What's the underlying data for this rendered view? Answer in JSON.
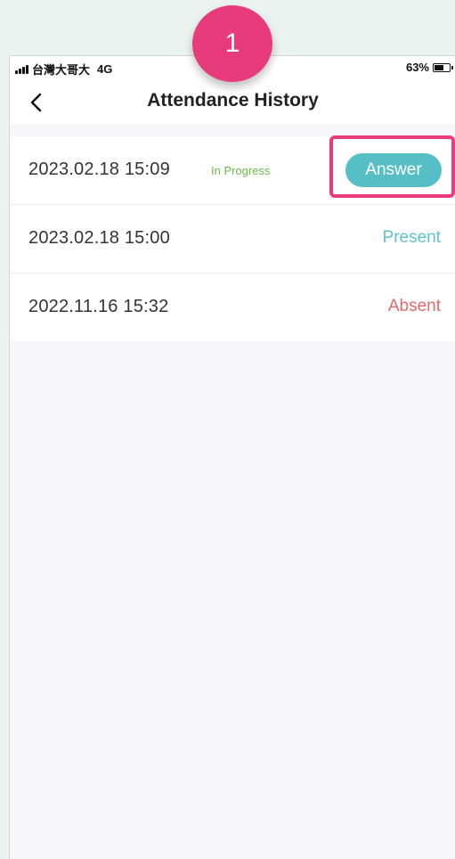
{
  "status_bar": {
    "carrier": "台灣大哥大",
    "network": "4G",
    "battery_percent": "63%"
  },
  "nav": {
    "title": "Attendance History",
    "back_icon": "chevron-left-icon"
  },
  "records": [
    {
      "datetime": "2023.02.18 15:09",
      "badge": "In Progress",
      "action_label": "Answer"
    },
    {
      "datetime": "2023.02.18 15:00",
      "status": "Present",
      "status_color": "#5bc4c9"
    },
    {
      "datetime": "2022.11.16 15:32",
      "status": "Absent",
      "status_color": "#e06a6a"
    }
  ],
  "annotation": {
    "step_number": "1",
    "accent_color": "#e83b7b"
  }
}
